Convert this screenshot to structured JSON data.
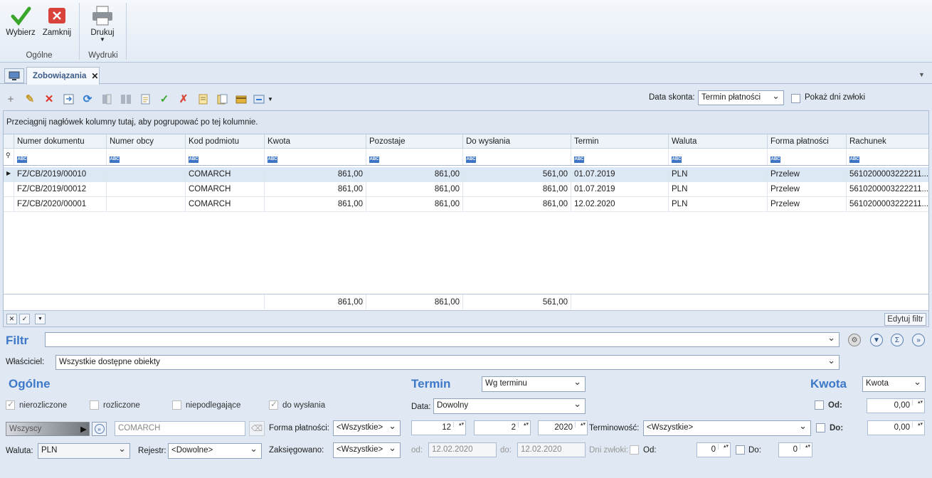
{
  "ribbon": {
    "select_label": "Wybierz",
    "close_label": "Zamknij",
    "group_general": "Ogólne",
    "print_label": "Drukuj",
    "group_prints": "Wydruki"
  },
  "tab": {
    "title": "Zobowiązania",
    "close": "✕"
  },
  "toolbar": {
    "discount_date_label": "Data skonta:",
    "discount_date_value": "Termin płatności",
    "show_overdue_label": "Pokaż dni zwłoki"
  },
  "grid": {
    "group_hint": "Przeciągnij nagłówek kolumny tutaj, aby pogrupować po tej kolumnie.",
    "filter_badge": "ABC",
    "columns": [
      "Numer dokumentu",
      "Numer obcy",
      "Kod podmiotu",
      "Kwota",
      "Pozostaje",
      "Do wysłania",
      "Termin",
      "Waluta",
      "Forma płatności",
      "Rachunek"
    ],
    "rows": [
      [
        "FZ/CB/2019/00010",
        "",
        "COMARCH",
        "861,00",
        "861,00",
        "561,00",
        "01.07.2019",
        "PLN",
        "Przelew",
        "5610200003222211..."
      ],
      [
        "FZ/CB/2019/00012",
        "",
        "COMARCH",
        "861,00",
        "861,00",
        "861,00",
        "01.07.2019",
        "PLN",
        "Przelew",
        "5610200003222211..."
      ],
      [
        "FZ/CB/2020/00001",
        "",
        "COMARCH",
        "861,00",
        "861,00",
        "861,00",
        "12.02.2020",
        "PLN",
        "Przelew",
        "5610200003222211..."
      ]
    ],
    "totals": {
      "kwota": "861,00",
      "pozostaje": "861,00",
      "do_wyslania": "561,00"
    },
    "edit_filter": "Edytuj filtr"
  },
  "filter": {
    "title": "Filtr",
    "owner_label": "Właściciel:",
    "owner_value": "Wszystkie dostępne obiekty",
    "general_title": "Ogólne",
    "cb_unsettled": "nierozliczone",
    "cb_settled": "rozliczone",
    "cb_exempt": "niepodlegające",
    "cb_to_send": "do wysłania",
    "subject_type": "Wszyscy",
    "subject_code": "COMARCH",
    "payment_form_label": "Forma płatności:",
    "payment_form_value": "<Wszystkie>",
    "currency_label": "Waluta:",
    "currency_value": "PLN",
    "register_label": "Rejestr:",
    "register_value": "<Dowolne>",
    "posted_label": "Zaksięgowano:",
    "posted_value": "<Wszystkie>",
    "term_title": "Termin",
    "term_mode": "Wg terminu",
    "date_label": "Data:",
    "date_value": "Dowolny",
    "month": "12",
    "day": "2",
    "year": "2020",
    "timeliness_label": "Terminowość:",
    "timeliness_value": "<Wszystkie>",
    "from_label": "od:",
    "from_date": "12.02.2020",
    "to_label": "do:",
    "to_date": "12.02.2020",
    "overdue_label": "Dni zwłoki:",
    "overdue_from_label": "Od:",
    "overdue_from": "0",
    "overdue_to_label": "Do:",
    "overdue_to": "0",
    "amount_title": "Kwota",
    "amount_mode": "Kwota",
    "amount_from_label": "Od:",
    "amount_from": "0,00",
    "amount_to_label": "Do:",
    "amount_to": "0,00"
  }
}
